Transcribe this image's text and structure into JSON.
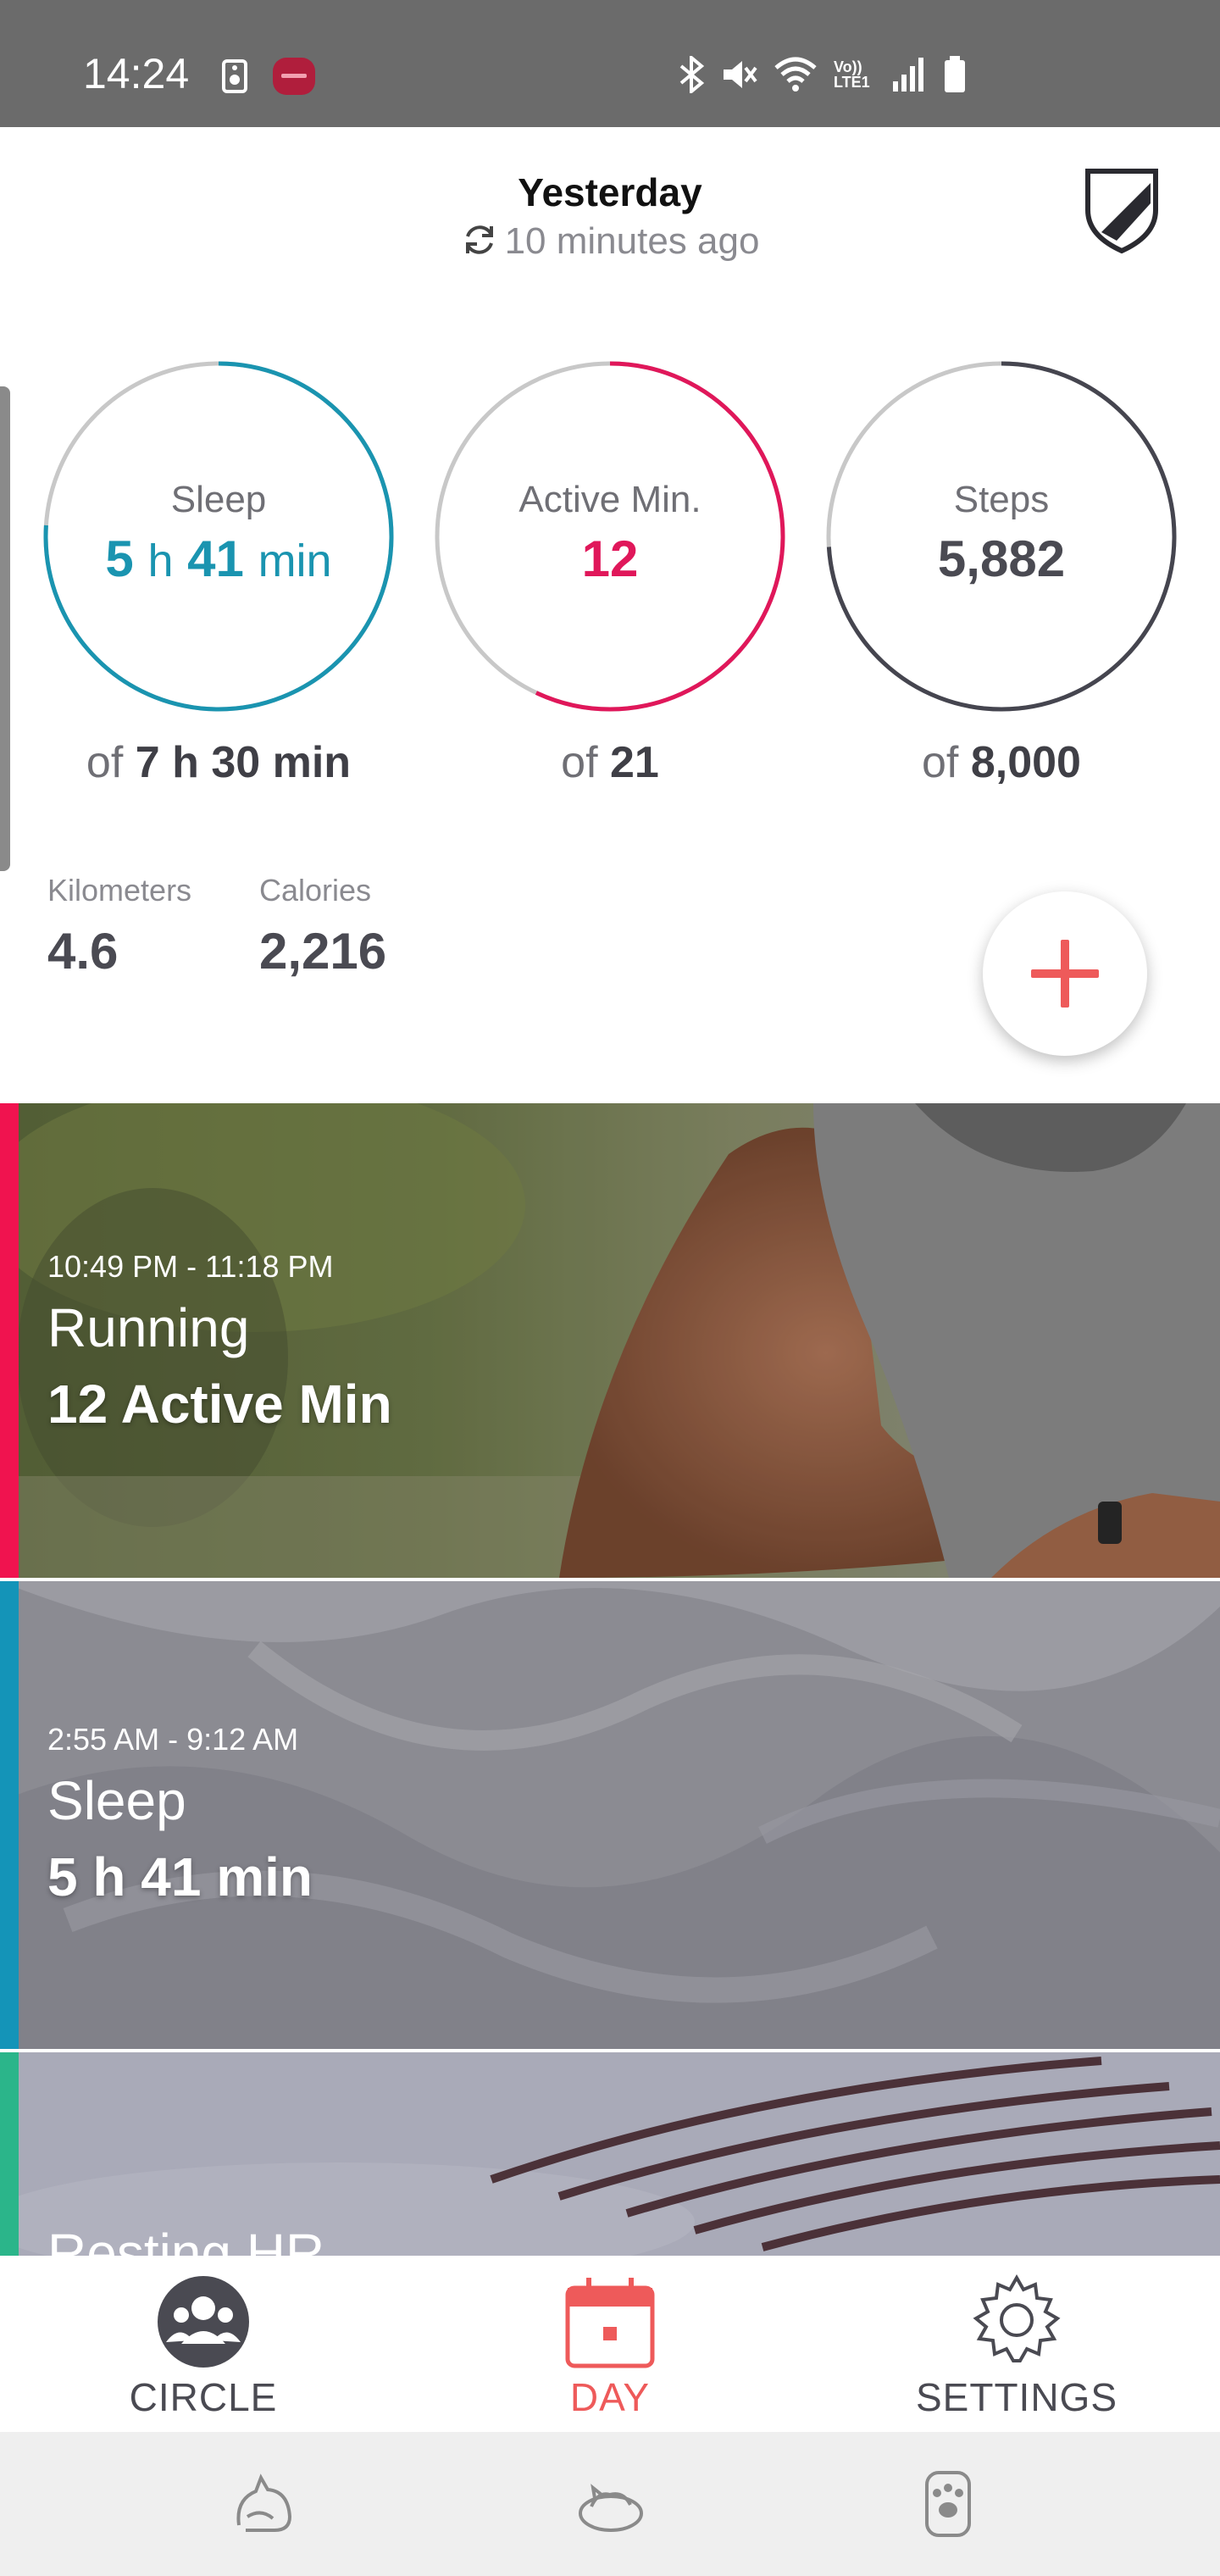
{
  "status_bar": {
    "time": "14:24",
    "left_icons": [
      "speaker-icon",
      "app-notification-icon"
    ],
    "right_icons": [
      "bluetooth-icon",
      "mute-icon",
      "wifi-icon",
      "volte-icon",
      "signal-icon",
      "battery-icon"
    ],
    "volte_text": "Vo)) LTE1"
  },
  "header": {
    "title": "Yesterday",
    "sync_text": "10 minutes ago"
  },
  "rings": [
    {
      "label": "Sleep",
      "value_num1": "5",
      "value_unit1": "h",
      "value_num2": "41",
      "value_unit2": "min",
      "goal_prefix": "of",
      "goal": "7 h 30 min",
      "progress": 0.76,
      "color": "#1a94b0"
    },
    {
      "label": "Active Min.",
      "value": "12",
      "goal_prefix": "of",
      "goal": "21",
      "progress": 0.57,
      "color": "#e0175a"
    },
    {
      "label": "Steps",
      "value": "5,882",
      "goal_prefix": "of",
      "goal": "8,000",
      "progress": 0.74,
      "color": "#45454f"
    }
  ],
  "ring_track_color": "#c8c8c8",
  "stats": {
    "kilometers_label": "Kilometers",
    "kilometers_value": "4.6",
    "calories_label": "Calories",
    "calories_value": "2,216"
  },
  "fab": {
    "icon": "plus-icon",
    "color": "#ee5a5a"
  },
  "cards": [
    {
      "time": "10:49 PM - 11:18 PM",
      "title": "Running",
      "value": "12 Active Min",
      "accent": "#f0134f"
    },
    {
      "time": "2:55 AM - 9:12 AM",
      "title": "Sleep",
      "value": "5 h 41 min",
      "accent": "#1494b8"
    },
    {
      "title": "Resting HR",
      "accent": "#2bb58a"
    }
  ],
  "bottom_nav": {
    "items": [
      {
        "label": "CIRCLE",
        "icon": "circle-people-icon",
        "active": false
      },
      {
        "label": "DAY",
        "icon": "calendar-icon",
        "active": true
      },
      {
        "label": "SETTINGS",
        "icon": "gear-icon",
        "active": false
      }
    ],
    "active_color": "#ee5a5a"
  },
  "system_bar": {
    "buttons": [
      "recents-cat-icon",
      "home-cat-icon",
      "back-paw-icon"
    ]
  }
}
